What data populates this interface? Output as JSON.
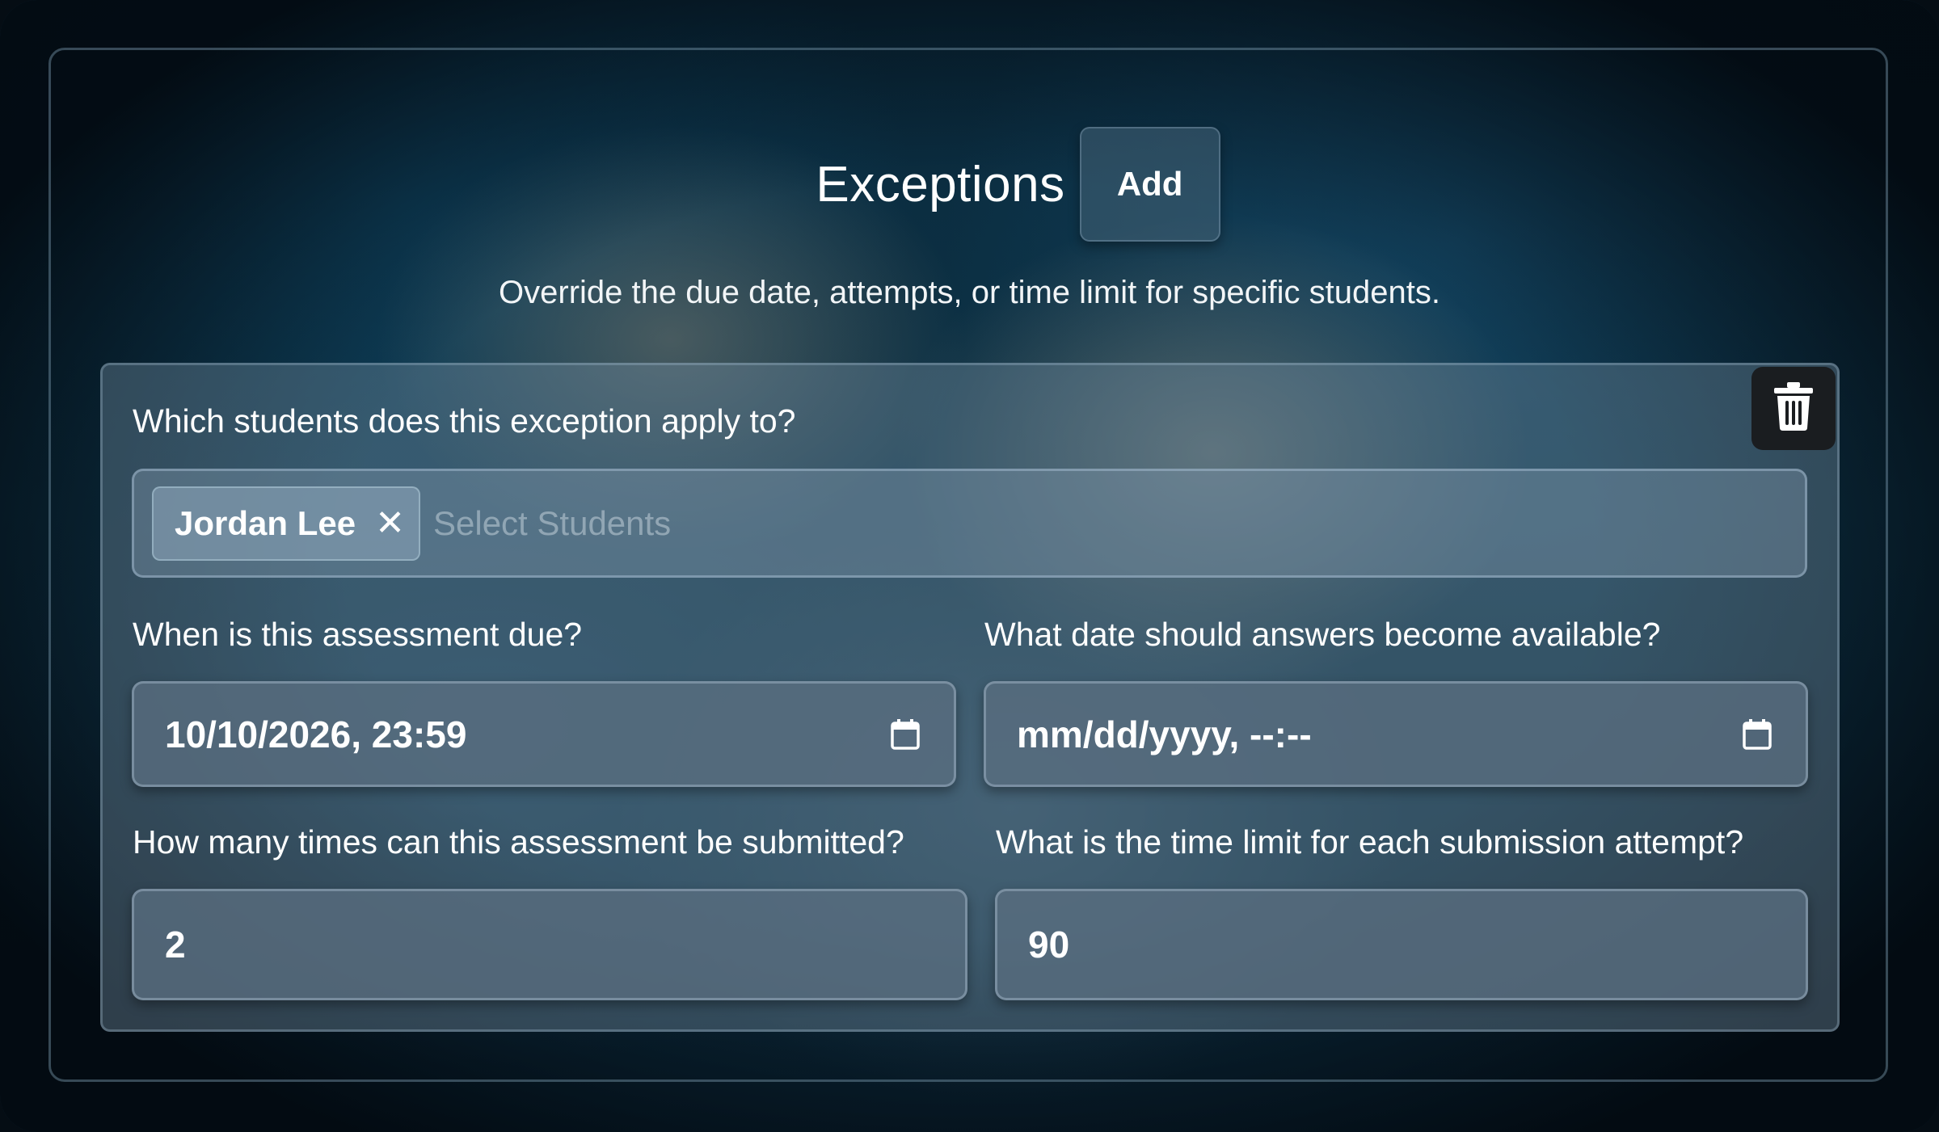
{
  "header": {
    "title": "Exceptions",
    "add_label": "Add"
  },
  "subtitle": "Override the due date, attempts, or time limit for specific students.",
  "exception": {
    "students_label": "Which students does this exception apply to?",
    "selected_students": [
      "Jordan Lee"
    ],
    "chip_remove": "✕",
    "students_placeholder": "Select Students",
    "due_label": "When is this assessment due?",
    "due_value": "10/10/2026, 23:59",
    "answers_label": "What date should answers become available?",
    "answers_value": "mm/dd/yyyy, --:--",
    "submissions_label": "How many times can this assessment be submitted?",
    "submissions_value": "2",
    "time_limit_label": "What is the time limit for each submission attempt?",
    "time_limit_value": "90"
  },
  "icons": {
    "delete": "trash-icon",
    "calendar": "calendar-icon",
    "remove": "close-icon"
  },
  "colors": {
    "delete_button_bg": "#1a1d20",
    "text": "#ffffff"
  }
}
